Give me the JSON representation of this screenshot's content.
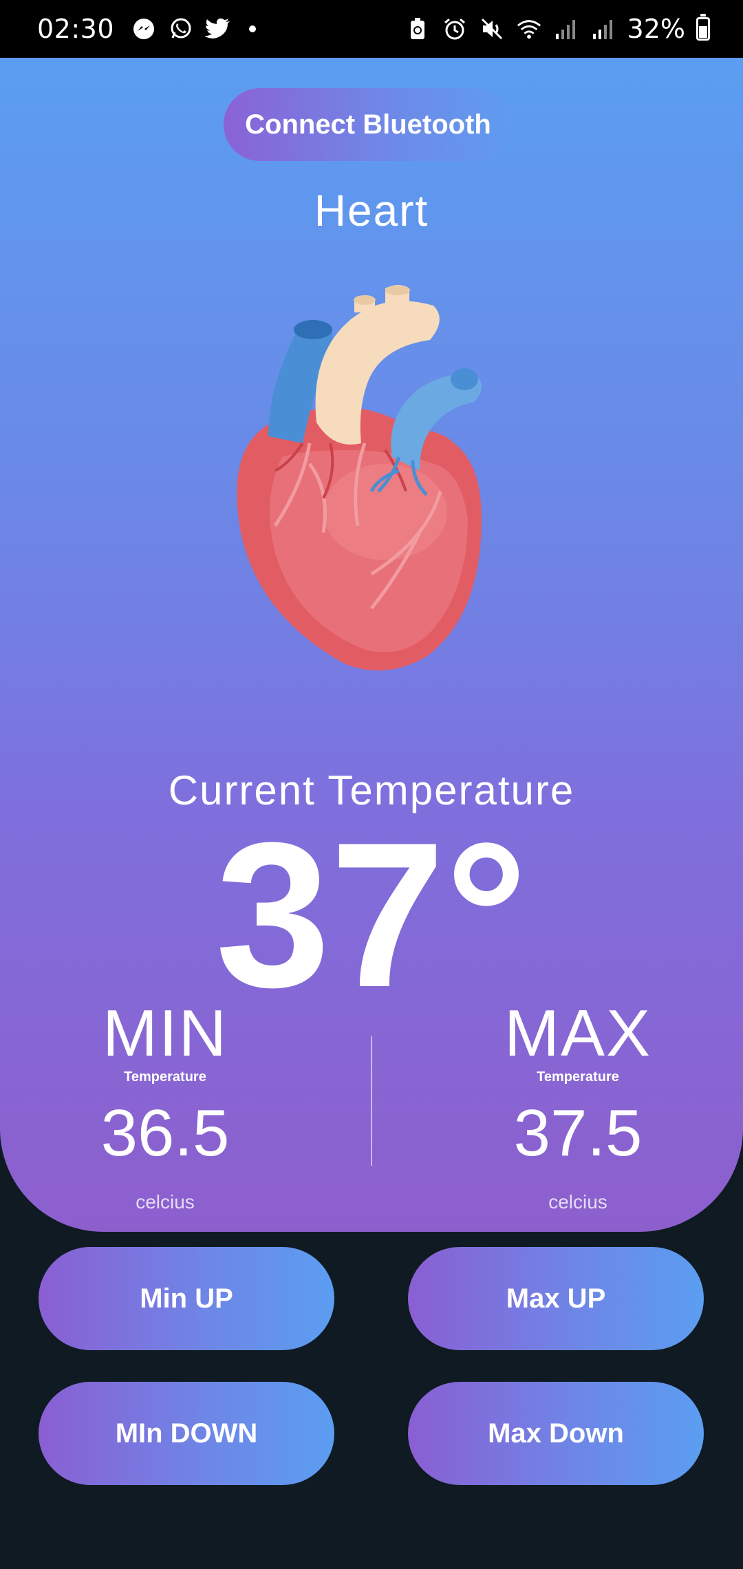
{
  "status_bar": {
    "time": "02:30",
    "battery": "32%",
    "left_icons": [
      "messenger-icon",
      "whatsapp-icon",
      "twitter-icon"
    ],
    "right_icons": [
      "battery-saver-icon",
      "alarm-icon",
      "mute-icon",
      "wifi-icon",
      "signal-icon",
      "signal-icon"
    ]
  },
  "header": {
    "connect_button": "Connect Bluetooth",
    "title": "Heart"
  },
  "temperature": {
    "label": "Current Temperature",
    "value": "37°"
  },
  "min": {
    "label": "MIN",
    "sub": "Temperature",
    "value": "36.5",
    "unit": "celcius"
  },
  "max": {
    "label": "MAX",
    "sub": "Temperature",
    "value": "37.5",
    "unit": "celcius"
  },
  "controls": {
    "min_up": "Min UP",
    "max_up": "Max UP",
    "min_down": "MIn DOWN",
    "max_down": "Max Down"
  },
  "colors": {
    "card_top": "#5b9ef1",
    "card_bottom": "#8d5fcd",
    "background": "#0f1a23"
  }
}
